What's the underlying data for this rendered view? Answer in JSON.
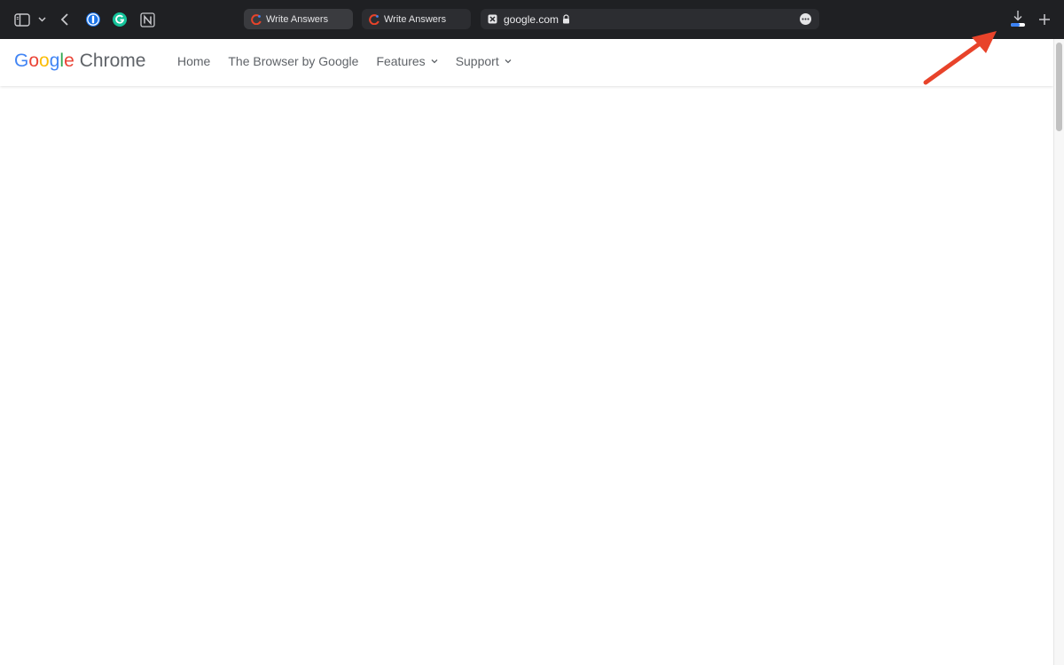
{
  "browser": {
    "tabs": [
      {
        "label": "Write Answers",
        "active": true
      },
      {
        "label": "Write Answers",
        "active": false
      }
    ],
    "address_bar": {
      "url": "google.com"
    },
    "icons": {
      "sidebar": "sidebar-icon",
      "back": "chevron-left-icon",
      "download": "download-icon",
      "new_tab": "plus-icon",
      "more": "ellipsis-icon",
      "lock": "lock-icon"
    }
  },
  "site": {
    "logo": {
      "google_letters": [
        "G",
        "o",
        "o",
        "g",
        "l",
        "e"
      ],
      "google_colors": [
        "#4285F4",
        "#EA4335",
        "#FBBC05",
        "#4285F4",
        "#34A853",
        "#EA4335"
      ],
      "product": "Chrome"
    },
    "nav": {
      "home": "Home",
      "browser": "The Browser by Google",
      "features": "Features",
      "support": "Support"
    }
  },
  "colors": {
    "toolbar_bg": "#1f2023",
    "annotation_arrow": "#e8432a",
    "download_progress": "#3b82f6"
  }
}
